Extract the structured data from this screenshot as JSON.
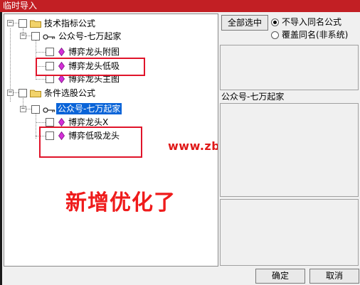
{
  "window": {
    "title": "临时导入"
  },
  "tree": {
    "groups": [
      {
        "label": "技术指标公式",
        "author": "公众号-七万起家",
        "items": [
          "博弈龙头附图",
          "博弈龙头低吸",
          "博弈龙头主图"
        ]
      },
      {
        "label": "条件选股公式",
        "author": "公众号-七万起家",
        "items": [
          "博弈龙头X",
          "博弈低吸龙头"
        ]
      }
    ]
  },
  "options": {
    "select_all_label": "全部选中",
    "radio_no_import": "不导入同名公式",
    "radio_overwrite": "覆盖同名(非系统)",
    "selected_option": "不导入同名公式"
  },
  "info": {
    "author_label": "公众号-七万起家"
  },
  "watermark": "www.zbzfwu.com",
  "overlay_text": "新增优化了",
  "footer": {
    "ok_label": "确定",
    "cancel_label": "取消"
  },
  "colors": {
    "titlebar": "#c21f24",
    "selection": "#0a64d8",
    "highlight_box": "#e0142a",
    "overlay_text": "#ef1b1b"
  }
}
